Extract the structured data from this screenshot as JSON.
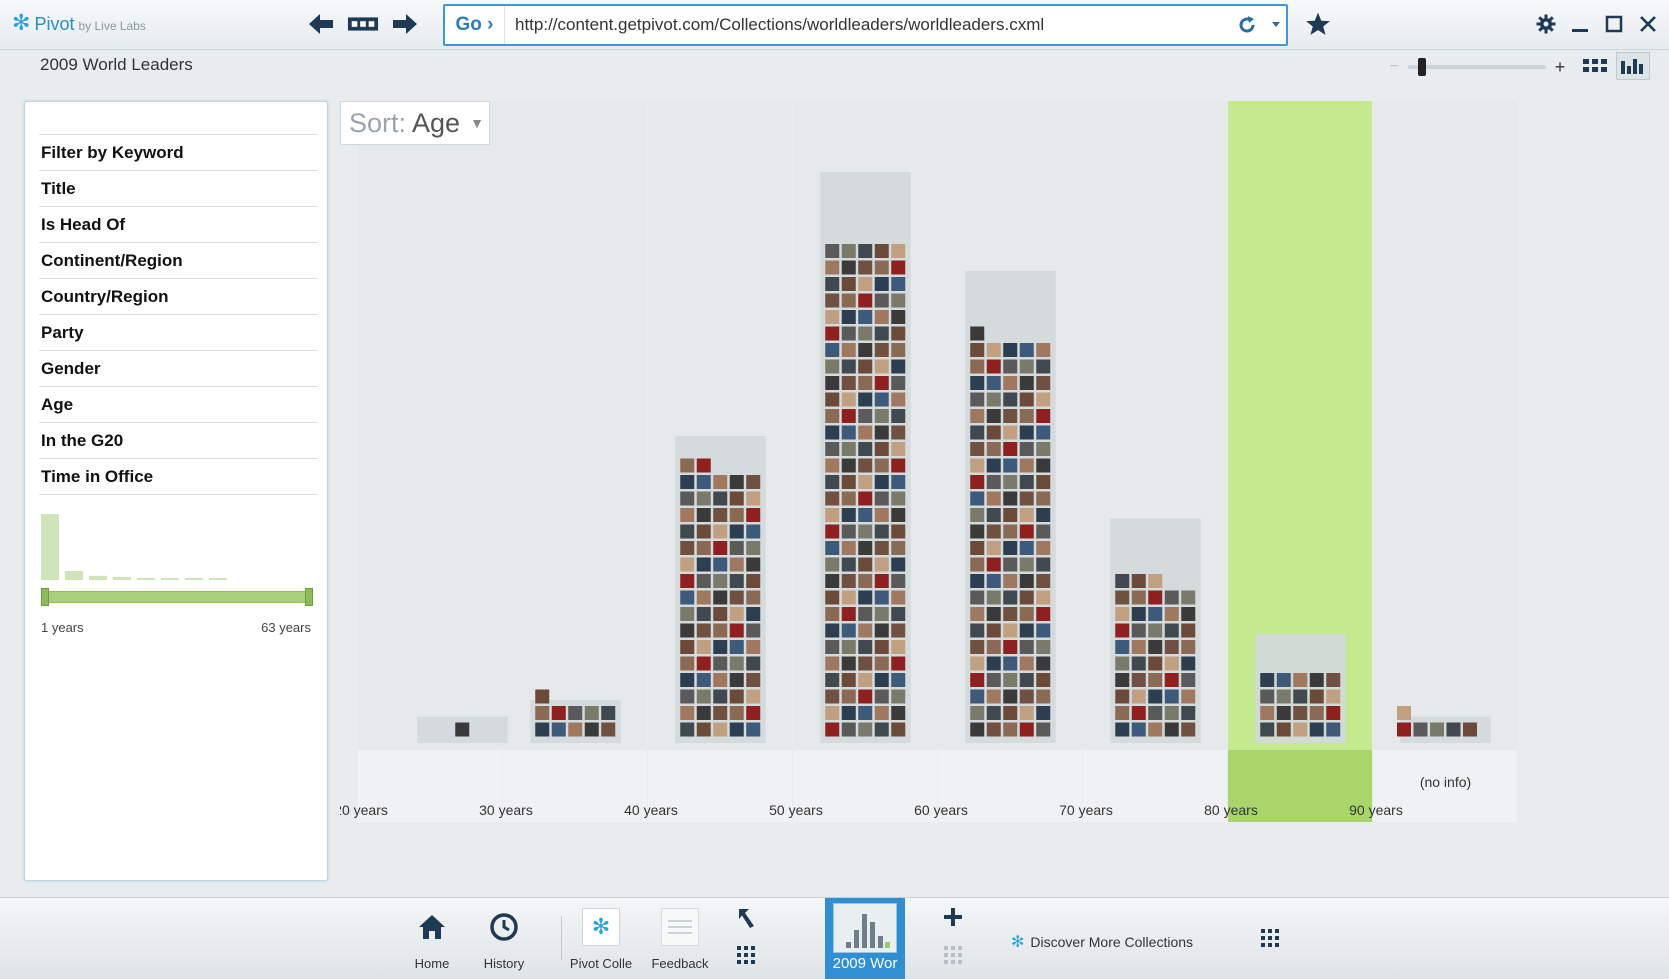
{
  "app": {
    "logo_name": "Pivot",
    "logo_sub": "by Live Labs",
    "icons": {
      "logo": "pivot-logo-icon",
      "back": "back-arrow-icon",
      "strip": "tab-strip-icon",
      "forward": "forward-arrow-icon"
    }
  },
  "address": {
    "go_label": "Go ›",
    "url": "http://content.getpivot.com/Collections/worldleaders/worldleaders.cxml"
  },
  "collection": {
    "title": "2009 World Leaders"
  },
  "filters": {
    "items": [
      {
        "label": "Filter by Keyword"
      },
      {
        "label": "Title"
      },
      {
        "label": "Is Head Of"
      },
      {
        "label": "Continent/Region"
      },
      {
        "label": "Country/Region"
      },
      {
        "label": "Party"
      },
      {
        "label": "Gender"
      },
      {
        "label": "Age"
      },
      {
        "label": "In the G20"
      },
      {
        "label": "Time in Office"
      }
    ],
    "time_in_office": {
      "min_label": "1 years",
      "max_label": "63 years",
      "histogram": [
        11,
        1.5,
        0.7,
        0.5,
        0.3,
        0.2,
        0.2,
        0.1
      ]
    }
  },
  "sort": {
    "label": "Sort:",
    "value": "Age"
  },
  "chart_data": {
    "type": "bar",
    "title": "",
    "categories": [
      "20 years",
      "30 years",
      "40 years",
      "50 years",
      "60 years",
      "70 years",
      "80 years",
      "(no info)"
    ],
    "values": [
      1,
      11,
      82,
      150,
      121,
      48,
      20,
      6
    ],
    "column_rows": [
      1,
      2,
      18,
      34,
      28,
      13,
      6,
      1
    ],
    "boundary_labels": [
      "20 years",
      "30 years",
      "40 years",
      "50 years",
      "60 years",
      "70 years",
      "80 years",
      "90 years"
    ],
    "other_label": "(no info)",
    "highlighted_index": 6,
    "colors": {
      "highlight": "#c4e98e",
      "column_bg": "#e4e8eb",
      "group_bg": "#d3d8db"
    }
  },
  "taskbar": {
    "home": "Home",
    "history": "History",
    "pivot_collections": "Pivot Colle",
    "feedback": "Feedback",
    "active_collection": "2009 Wor",
    "discover": "Discover More Collections"
  }
}
